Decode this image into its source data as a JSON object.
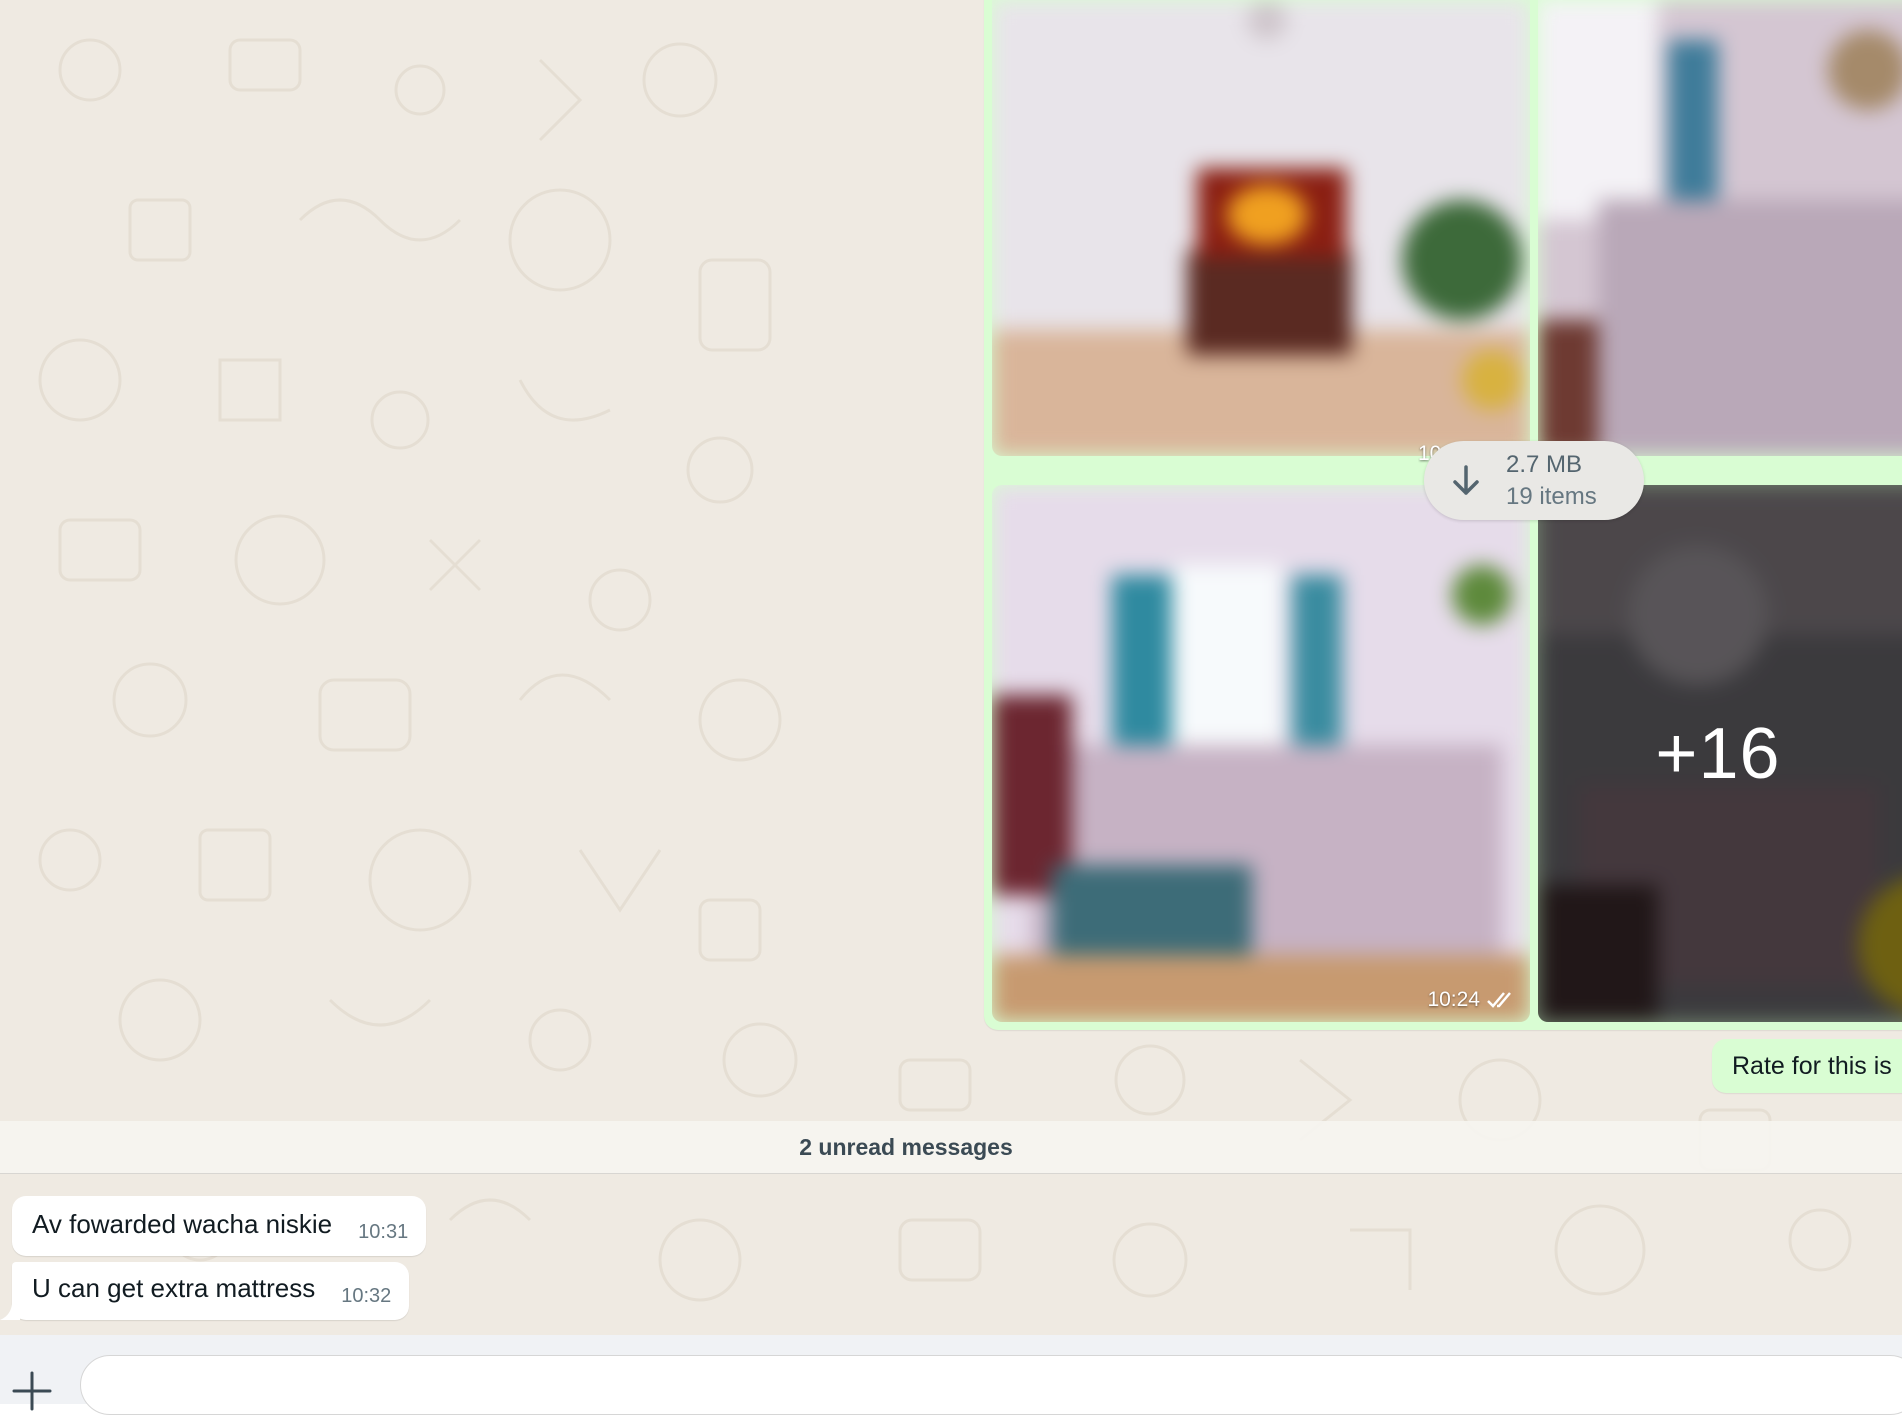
{
  "chat": {
    "album": {
      "download_size": "2.7 MB",
      "item_count": "19 items",
      "more_count": "+16",
      "time_partial": "10",
      "time": "10:24",
      "read_receipt_icon": "double-check-icon"
    },
    "outgoing_message": "Rate for this is",
    "unread_divider": "2 unread messages",
    "incoming": [
      {
        "text": "Av fowarded wacha niskie",
        "time": "10:31"
      },
      {
        "text": "U can get extra mattress",
        "time": "10:32"
      }
    ]
  },
  "composer": {
    "attach_icon": "plus-icon",
    "placeholder": ""
  },
  "colors": {
    "chat_background": "#efeae2",
    "outgoing_bubble": "#d9fdd3",
    "incoming_bubble": "#ffffff",
    "composer_background": "#f0f2f5"
  }
}
